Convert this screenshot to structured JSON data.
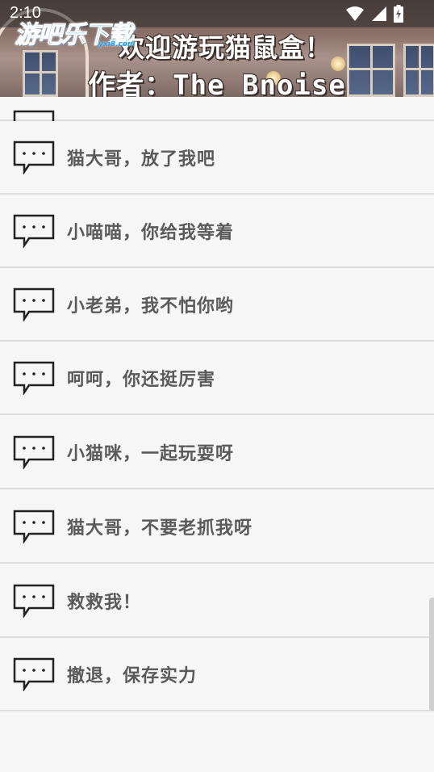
{
  "status_bar": {
    "time": "2:10",
    "icons": [
      "wifi-icon",
      "cellular-signal-icon",
      "battery-charging-icon"
    ]
  },
  "watermark": {
    "text": "游吧乐下载",
    "sub": "yxi8.com"
  },
  "header": {
    "line1": "欢迎游玩猫鼠盒！",
    "line2": "作者：The_Bnoise"
  },
  "list": {
    "item_icon": "speech-bubble-icon",
    "items": [
      {
        "label": "猫大哥，放了我吧"
      },
      {
        "label": "小喵喵，你给我等着"
      },
      {
        "label": "小老弟，我不怕你哟"
      },
      {
        "label": "呵呵，你还挺厉害"
      },
      {
        "label": "小猫咪，一起玩耍呀"
      },
      {
        "label": "猫大哥，不要老抓我呀"
      },
      {
        "label": "救救我！"
      },
      {
        "label": "撤退，保存实力"
      }
    ]
  },
  "colors": {
    "background": "#f6f6f6",
    "divider": "#dcdcdc",
    "label_text": "#5a5a5a",
    "icon_stroke": "#222222",
    "watermark": "#1e9ef0"
  }
}
